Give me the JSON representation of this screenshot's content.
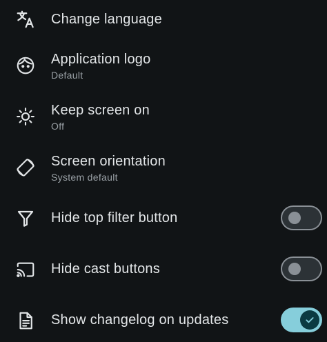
{
  "settings": {
    "items": [
      {
        "icon": "translate-icon",
        "title": "Change language",
        "subtitle": ""
      },
      {
        "icon": "app-logo-icon",
        "title": "Application logo",
        "subtitle": "Default"
      },
      {
        "icon": "brightness-icon",
        "title": "Keep screen on",
        "subtitle": "Off"
      },
      {
        "icon": "screen-rotation-icon",
        "title": "Screen orientation",
        "subtitle": "System default"
      },
      {
        "icon": "filter-icon",
        "title": "Hide top filter button",
        "subtitle": "",
        "toggle": false
      },
      {
        "icon": "cast-icon",
        "title": "Hide cast buttons",
        "subtitle": "",
        "toggle": false
      },
      {
        "icon": "changelog-icon",
        "title": "Show changelog on updates",
        "subtitle": "",
        "toggle": true
      }
    ]
  },
  "colors": {
    "background": "#111416",
    "text_primary": "#e3e6e8",
    "text_secondary": "#9aa1a6",
    "switch_on_track": "#86cedb",
    "switch_off_outline": "#8a9096"
  }
}
